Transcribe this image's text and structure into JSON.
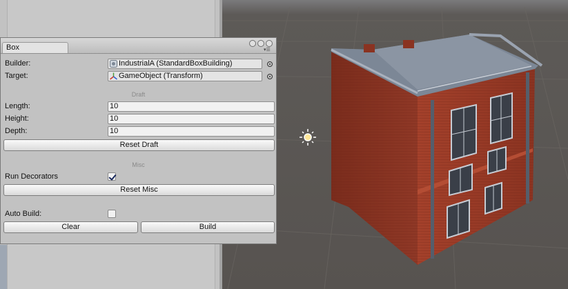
{
  "window": {
    "tab_title": "Box"
  },
  "fields": {
    "builder": {
      "label": "Builder:",
      "value": "IndustrialA (StandardBoxBuilding)",
      "icon": "script-asset-icon"
    },
    "target": {
      "label": "Target:",
      "value": "GameObject (Transform)",
      "icon": "transform-axis-icon"
    }
  },
  "draft": {
    "header": "Draft",
    "length": {
      "label": "Length:",
      "value": "10"
    },
    "height": {
      "label": "Height:",
      "value": "10"
    },
    "depth": {
      "label": "Depth:",
      "value": "10"
    },
    "reset_label": "Reset Draft"
  },
  "misc": {
    "header": "Misc",
    "run_decorators": {
      "label": "Run Decorators",
      "checked": true
    },
    "reset_label": "Reset Misc"
  },
  "auto_build": {
    "label": "Auto Build:",
    "checked": false
  },
  "actions": {
    "clear_label": "Clear",
    "build_label": "Build"
  },
  "colors": {
    "scene_bg": "#595550",
    "brick": "#9b3b27",
    "roof": "#7c8796"
  }
}
